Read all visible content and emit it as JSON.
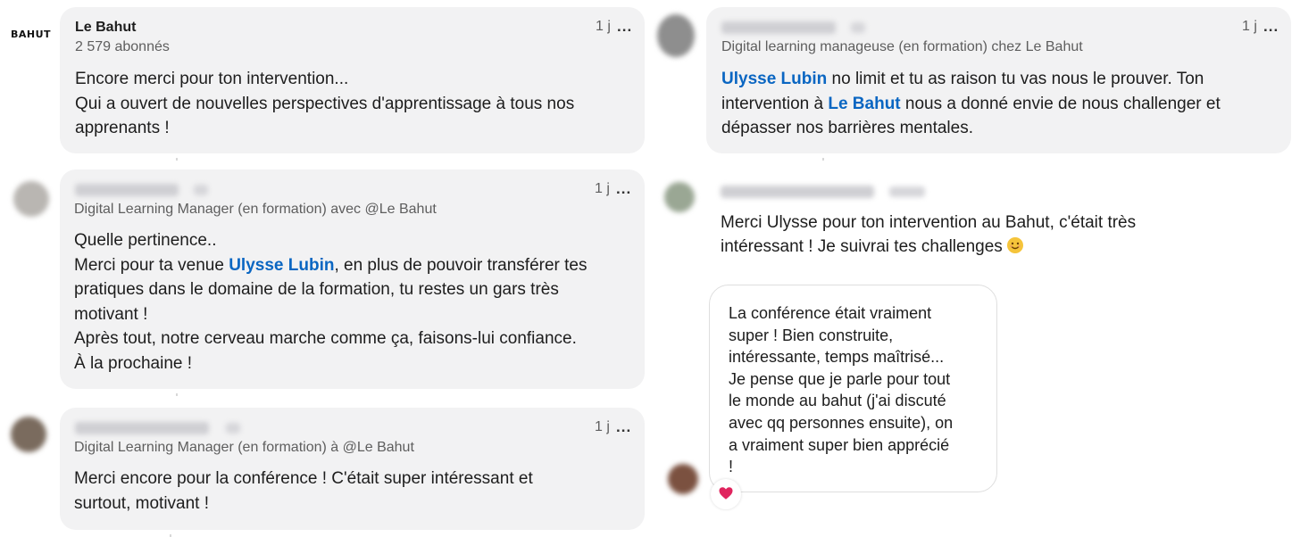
{
  "comments": [
    {
      "author": "Le Bahut",
      "logo_text": "BAHUT",
      "followers": "2 579 abonnés",
      "time": "1 j",
      "menu": "...",
      "lines": [
        "Encore merci pour ton intervention...",
        "Qui a ouvert de nouvelles perspectives d'apprentissage à tous nos",
        "apprenants !"
      ]
    },
    {
      "headline": "Digital Learning Manager (en formation) avec @Le Bahut",
      "time": "1 j",
      "menu": "...",
      "line1": "Quelle pertinence..",
      "line2_before": "Merci pour ta venue ",
      "line2_mention": "Ulysse Lubin",
      "line2_after": ", en plus de pouvoir transférer tes",
      "line3": "pratiques dans le domaine de la formation, tu restes un gars très",
      "line4": "motivant !",
      "line5": "Après tout, notre cerveau marche comme ça, faisons-lui confiance.",
      "line6": "À la prochaine !"
    },
    {
      "headline": "Digital Learning Manager (en formation) à @Le Bahut",
      "time": "1 j",
      "menu": "...",
      "lines": [
        "Merci encore pour la conférence ! C'était super intéressant et",
        "surtout, motivant !"
      ]
    },
    {
      "headline": "Digital learning manageuse (en formation) chez Le Bahut",
      "time": "1 j",
      "menu": "...",
      "line1_mention": "Ulysse Lubin",
      "line1_after": " no limit et tu as raison tu vas nous le prouver. Ton",
      "line2_before": "intervention à ",
      "line2_mention": "Le Bahut",
      "line2_after": " nous a donné envie de nous challenger et",
      "line3": "dépasser nos barrières mentales."
    },
    {
      "line1": "Merci Ulysse pour ton intervention au Bahut, c'était très",
      "line2": "intéressant ! Je suivrai tes challenges",
      "emoji": "smiling-face-emoji"
    },
    {
      "lines": [
        "La conférence était vraiment",
        "super ! Bien construite,",
        "intéressante, temps maîtrisé...",
        "Je pense que je parle pour tout",
        "le monde au bahut (j'ai discuté",
        "avec qq personnes ensuite), on",
        "a vraiment super bien apprécié",
        "!"
      ],
      "reaction": "heart-icon",
      "reaction_color": "#e0245e"
    }
  ]
}
